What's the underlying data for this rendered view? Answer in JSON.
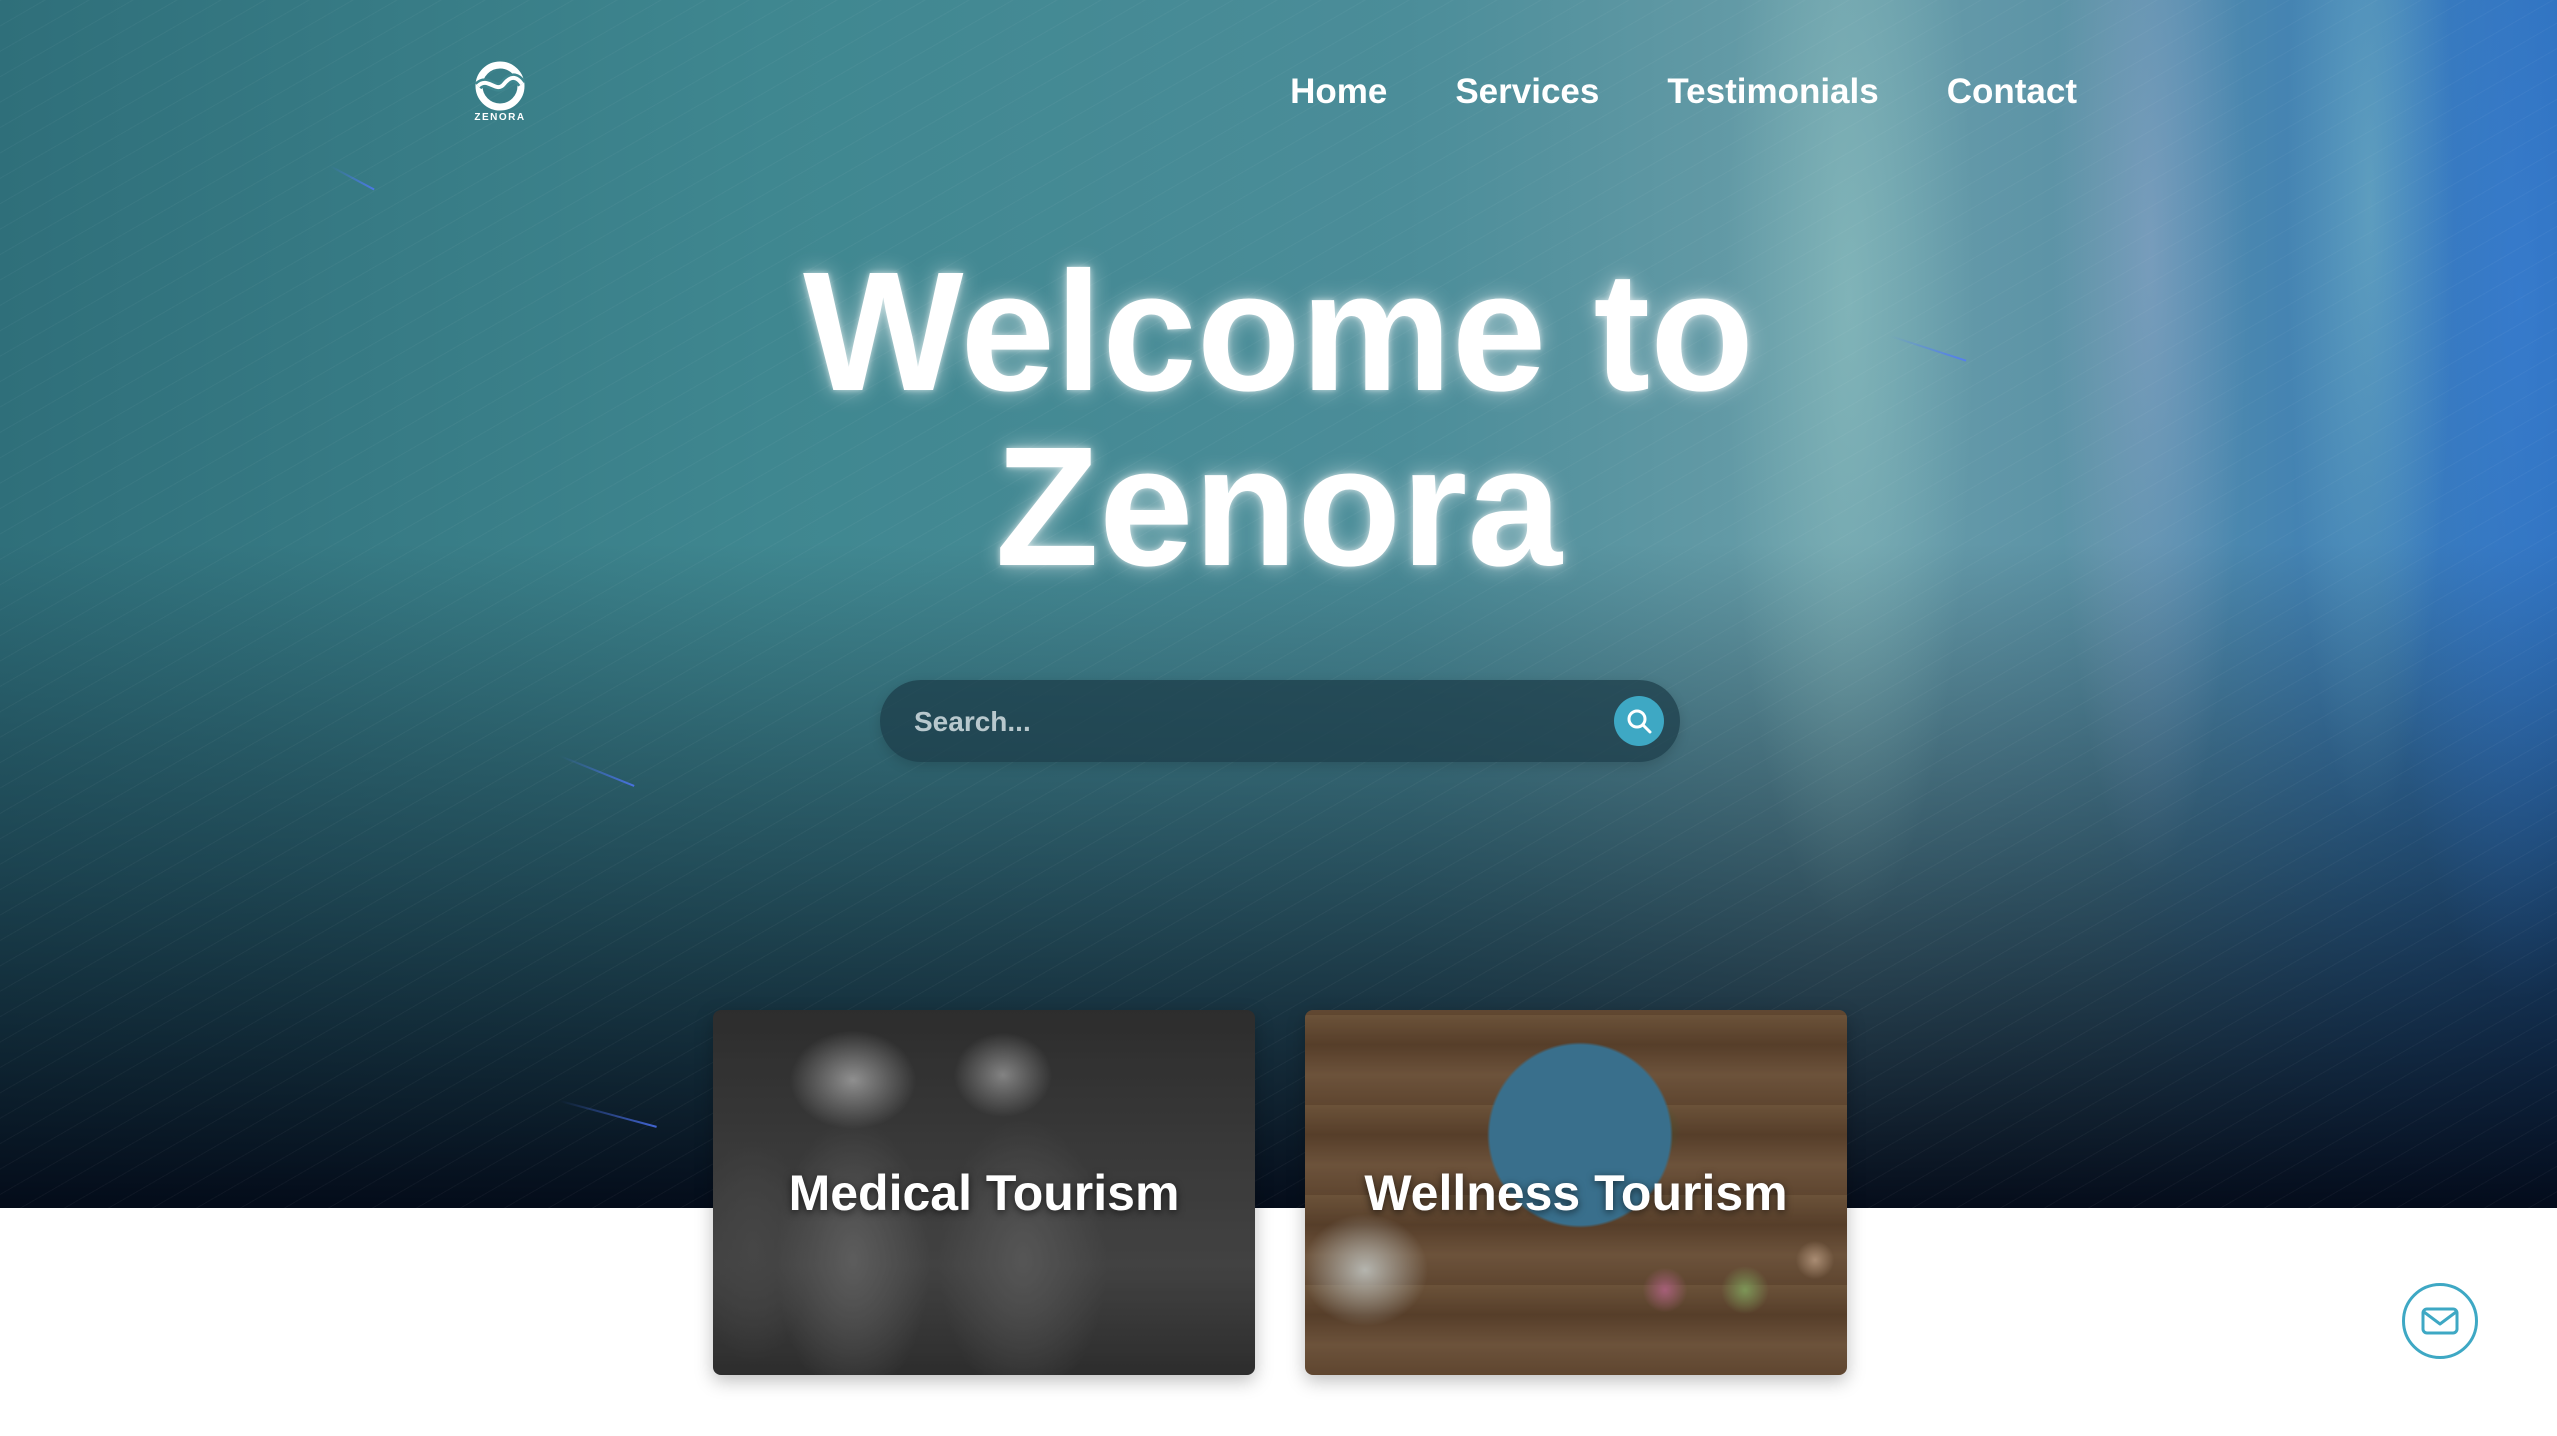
{
  "brand": {
    "name": "ZENORA"
  },
  "nav": {
    "items": [
      {
        "label": "Home"
      },
      {
        "label": "Services"
      },
      {
        "label": "Testimonials"
      },
      {
        "label": "Contact"
      }
    ]
  },
  "hero": {
    "title_line1": "Welcome to",
    "title_line2": "Zenora"
  },
  "search": {
    "placeholder": "Search...",
    "value": "",
    "icon": "search-icon"
  },
  "cards": [
    {
      "title": "Medical Tourism"
    },
    {
      "title": "Wellness Tourism"
    }
  ],
  "contact_fab": {
    "icon": "mail-icon"
  },
  "colors": {
    "accent": "#3ea8c4",
    "hero_top": "#3f8790",
    "hero_bottom": "#020816",
    "text_on_hero": "#ffffff"
  }
}
